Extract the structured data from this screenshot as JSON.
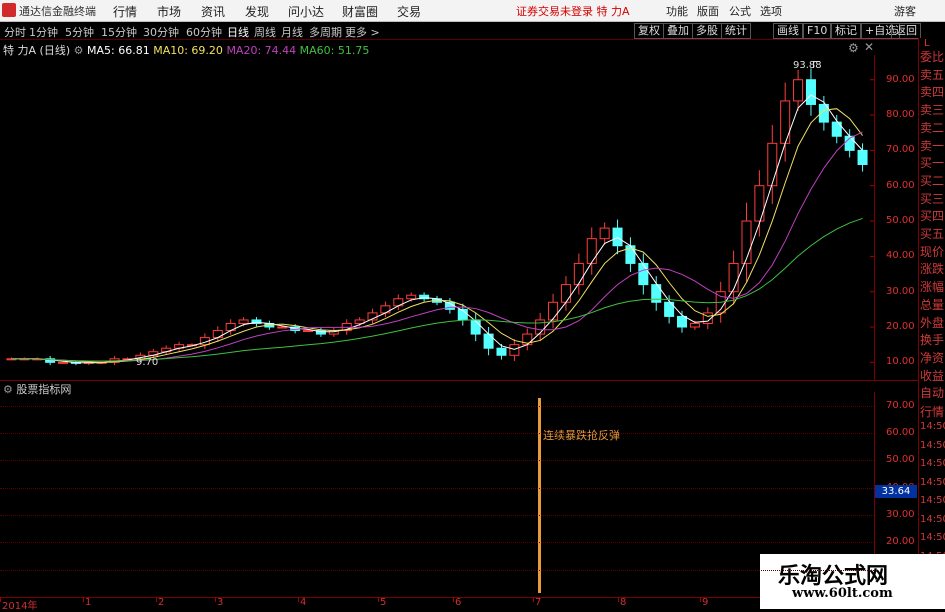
{
  "menubar": {
    "app_title": "通达信金融终端",
    "items": [
      "行情",
      "市场",
      "资讯",
      "发现",
      "问小达",
      "财富圈",
      "交易"
    ],
    "warning": "证券交易未登录  特 力A",
    "right_items": [
      "功能",
      "版面",
      "公式",
      "选项"
    ],
    "guest": "游客"
  },
  "toolbar": {
    "periods": [
      "分时",
      "1分钟",
      "5分钟",
      "15分钟",
      "30分钟",
      "60分钟",
      "日线",
      "周线",
      "月线",
      "多周期",
      "更多 >"
    ],
    "active": "日线",
    "right_buttons": [
      "复权",
      "叠加",
      "多股",
      "统计",
      "画线",
      "F10",
      "标记",
      "+自选",
      "返回"
    ]
  },
  "price_header": {
    "stock": "特 力A",
    "period": "(日线)",
    "ma5": "MA5: 66.81",
    "ma10": "MA10: 69.20",
    "ma20": "MA20: 74.44",
    "ma60": "MA60: 51.75",
    "colors": {
      "ma5": "#ffffff",
      "ma10": "#f0e060",
      "ma20": "#c040c0",
      "ma60": "#40c040"
    }
  },
  "chart_data": {
    "type": "candlestick",
    "y_ticks": [
      "90.00",
      "80.00",
      "70.00",
      "60.00",
      "50.00",
      "40.00",
      "30.00",
      "20.00",
      "10.00"
    ],
    "ylim": [
      5,
      97
    ],
    "high_label": "93.88",
    "low_label": "9.70",
    "x_labels": [
      "2014年",
      "1",
      "2",
      "3",
      "4",
      "5",
      "6",
      "7",
      "8",
      "9"
    ],
    "close_path": [
      11,
      11,
      11,
      10,
      10,
      9.7,
      10,
      10,
      11,
      11,
      12,
      13,
      14,
      15,
      15,
      17,
      19,
      21,
      22,
      21,
      20,
      20,
      19,
      19,
      18,
      19,
      21,
      22,
      24,
      26,
      28,
      29,
      28,
      27,
      25,
      22,
      18,
      14,
      12,
      15,
      18,
      22,
      27,
      32,
      38,
      45,
      48,
      43,
      38,
      32,
      27,
      23,
      20,
      21,
      24,
      30,
      38,
      50,
      60,
      72,
      84,
      90,
      83,
      78,
      74,
      70,
      66
    ]
  },
  "sub_chart": {
    "title": "股票指标网",
    "y_ticks": [
      "70.00",
      "60.00",
      "50.00",
      "40.00",
      "30.00",
      "20.00",
      "10.00"
    ],
    "signal_text": "连续暴跌抢反弹",
    "value_badge": "33.64"
  },
  "side_panel": {
    "corner": "L",
    "items": [
      "委比",
      "卖五",
      "卖四",
      "卖三",
      "卖二",
      "卖一",
      "买一",
      "买二",
      "买三",
      "买四",
      "买五",
      "现价",
      "涨跌",
      "涨幅",
      "总量",
      "外盘",
      "换手",
      "净资",
      "收益"
    ],
    "lower_items": [
      "自动",
      "行情",
      "14:50",
      "14:50",
      "14:50",
      "14:50",
      "14:50",
      "14:50",
      "14:50",
      "14:50",
      "14:50",
      "14:50"
    ]
  },
  "watermark": {
    "title": "乐淘公式网",
    "url": "www.60lt.com"
  }
}
